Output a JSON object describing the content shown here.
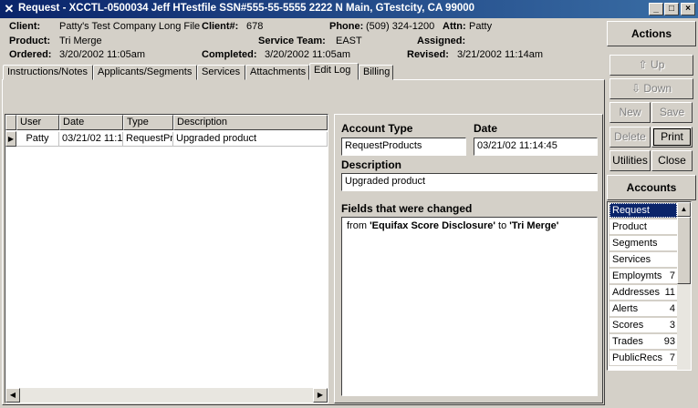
{
  "window": {
    "title": "Request - XCCTL-0500034  Jeff HTestfile  SSN#555-55-5555  2222 N Main, GTestcity, CA 99000",
    "minimize": "_",
    "maximize": "□",
    "close": "×"
  },
  "info": {
    "client_label": "Client:",
    "client_value": "Patty's Test Company Long File",
    "clientnum_label": "Client#:",
    "clientnum_value": "678",
    "phone_label": "Phone:",
    "phone_value": "(509) 324-1200",
    "attn_label": "Attn:",
    "attn_value": "Patty",
    "product_label": "Product:",
    "product_value": "Tri Merge",
    "team_label": "Service Team:",
    "team_value": "EAST",
    "assigned_label": "Assigned:",
    "assigned_value": "",
    "ordered_label": "Ordered:",
    "ordered_value": "3/20/2002 11:05am",
    "completed_label": "Completed:",
    "completed_value": "3/20/2002 11:05am",
    "revised_label": "Revised:",
    "revised_value": "3/21/2002 11:14am"
  },
  "tabs": [
    {
      "label": "Instructions/Notes"
    },
    {
      "label": "Applicants/Segments"
    },
    {
      "label": "Services"
    },
    {
      "label": "Attachments"
    },
    {
      "label": "Edit Log"
    },
    {
      "label": "Billing"
    }
  ],
  "grid": {
    "headers": [
      "User",
      "Date",
      "Type",
      "Description"
    ],
    "rows": [
      {
        "user": "Patty",
        "date": "03/21/02 11:1",
        "type": "RequestPro",
        "description": "Upgraded product"
      }
    ]
  },
  "detail": {
    "account_type_label": "Account Type",
    "account_type_value": "RequestProducts",
    "date_label": "Date",
    "date_value": "03/21/02 11:14:45",
    "description_label": "Description",
    "description_value": "Upgraded product",
    "changed_label": "Fields that were changed",
    "changed_from_prefix": "from",
    "changed_from": "'Equifax Score Disclosure'",
    "changed_to_word": "to",
    "changed_to": "'Tri Merge'"
  },
  "actions": {
    "header": "Actions",
    "up": "Up",
    "down": "Down",
    "new": "New",
    "save": "Save",
    "delete": "Delete",
    "print": "Print",
    "utilities": "Utilities",
    "close": "Close"
  },
  "accounts": {
    "header": "Accounts",
    "items": [
      {
        "label": "Request",
        "count": ""
      },
      {
        "label": "Product",
        "count": ""
      },
      {
        "label": "Segments",
        "count": ""
      },
      {
        "label": "Services",
        "count": ""
      },
      {
        "label": "Employmts",
        "count": "7"
      },
      {
        "label": "Addresses",
        "count": "11"
      },
      {
        "label": "Alerts",
        "count": "4"
      },
      {
        "label": "Scores",
        "count": "3"
      },
      {
        "label": "Trades",
        "count": "93"
      },
      {
        "label": "PublicRecs",
        "count": "7"
      }
    ]
  }
}
